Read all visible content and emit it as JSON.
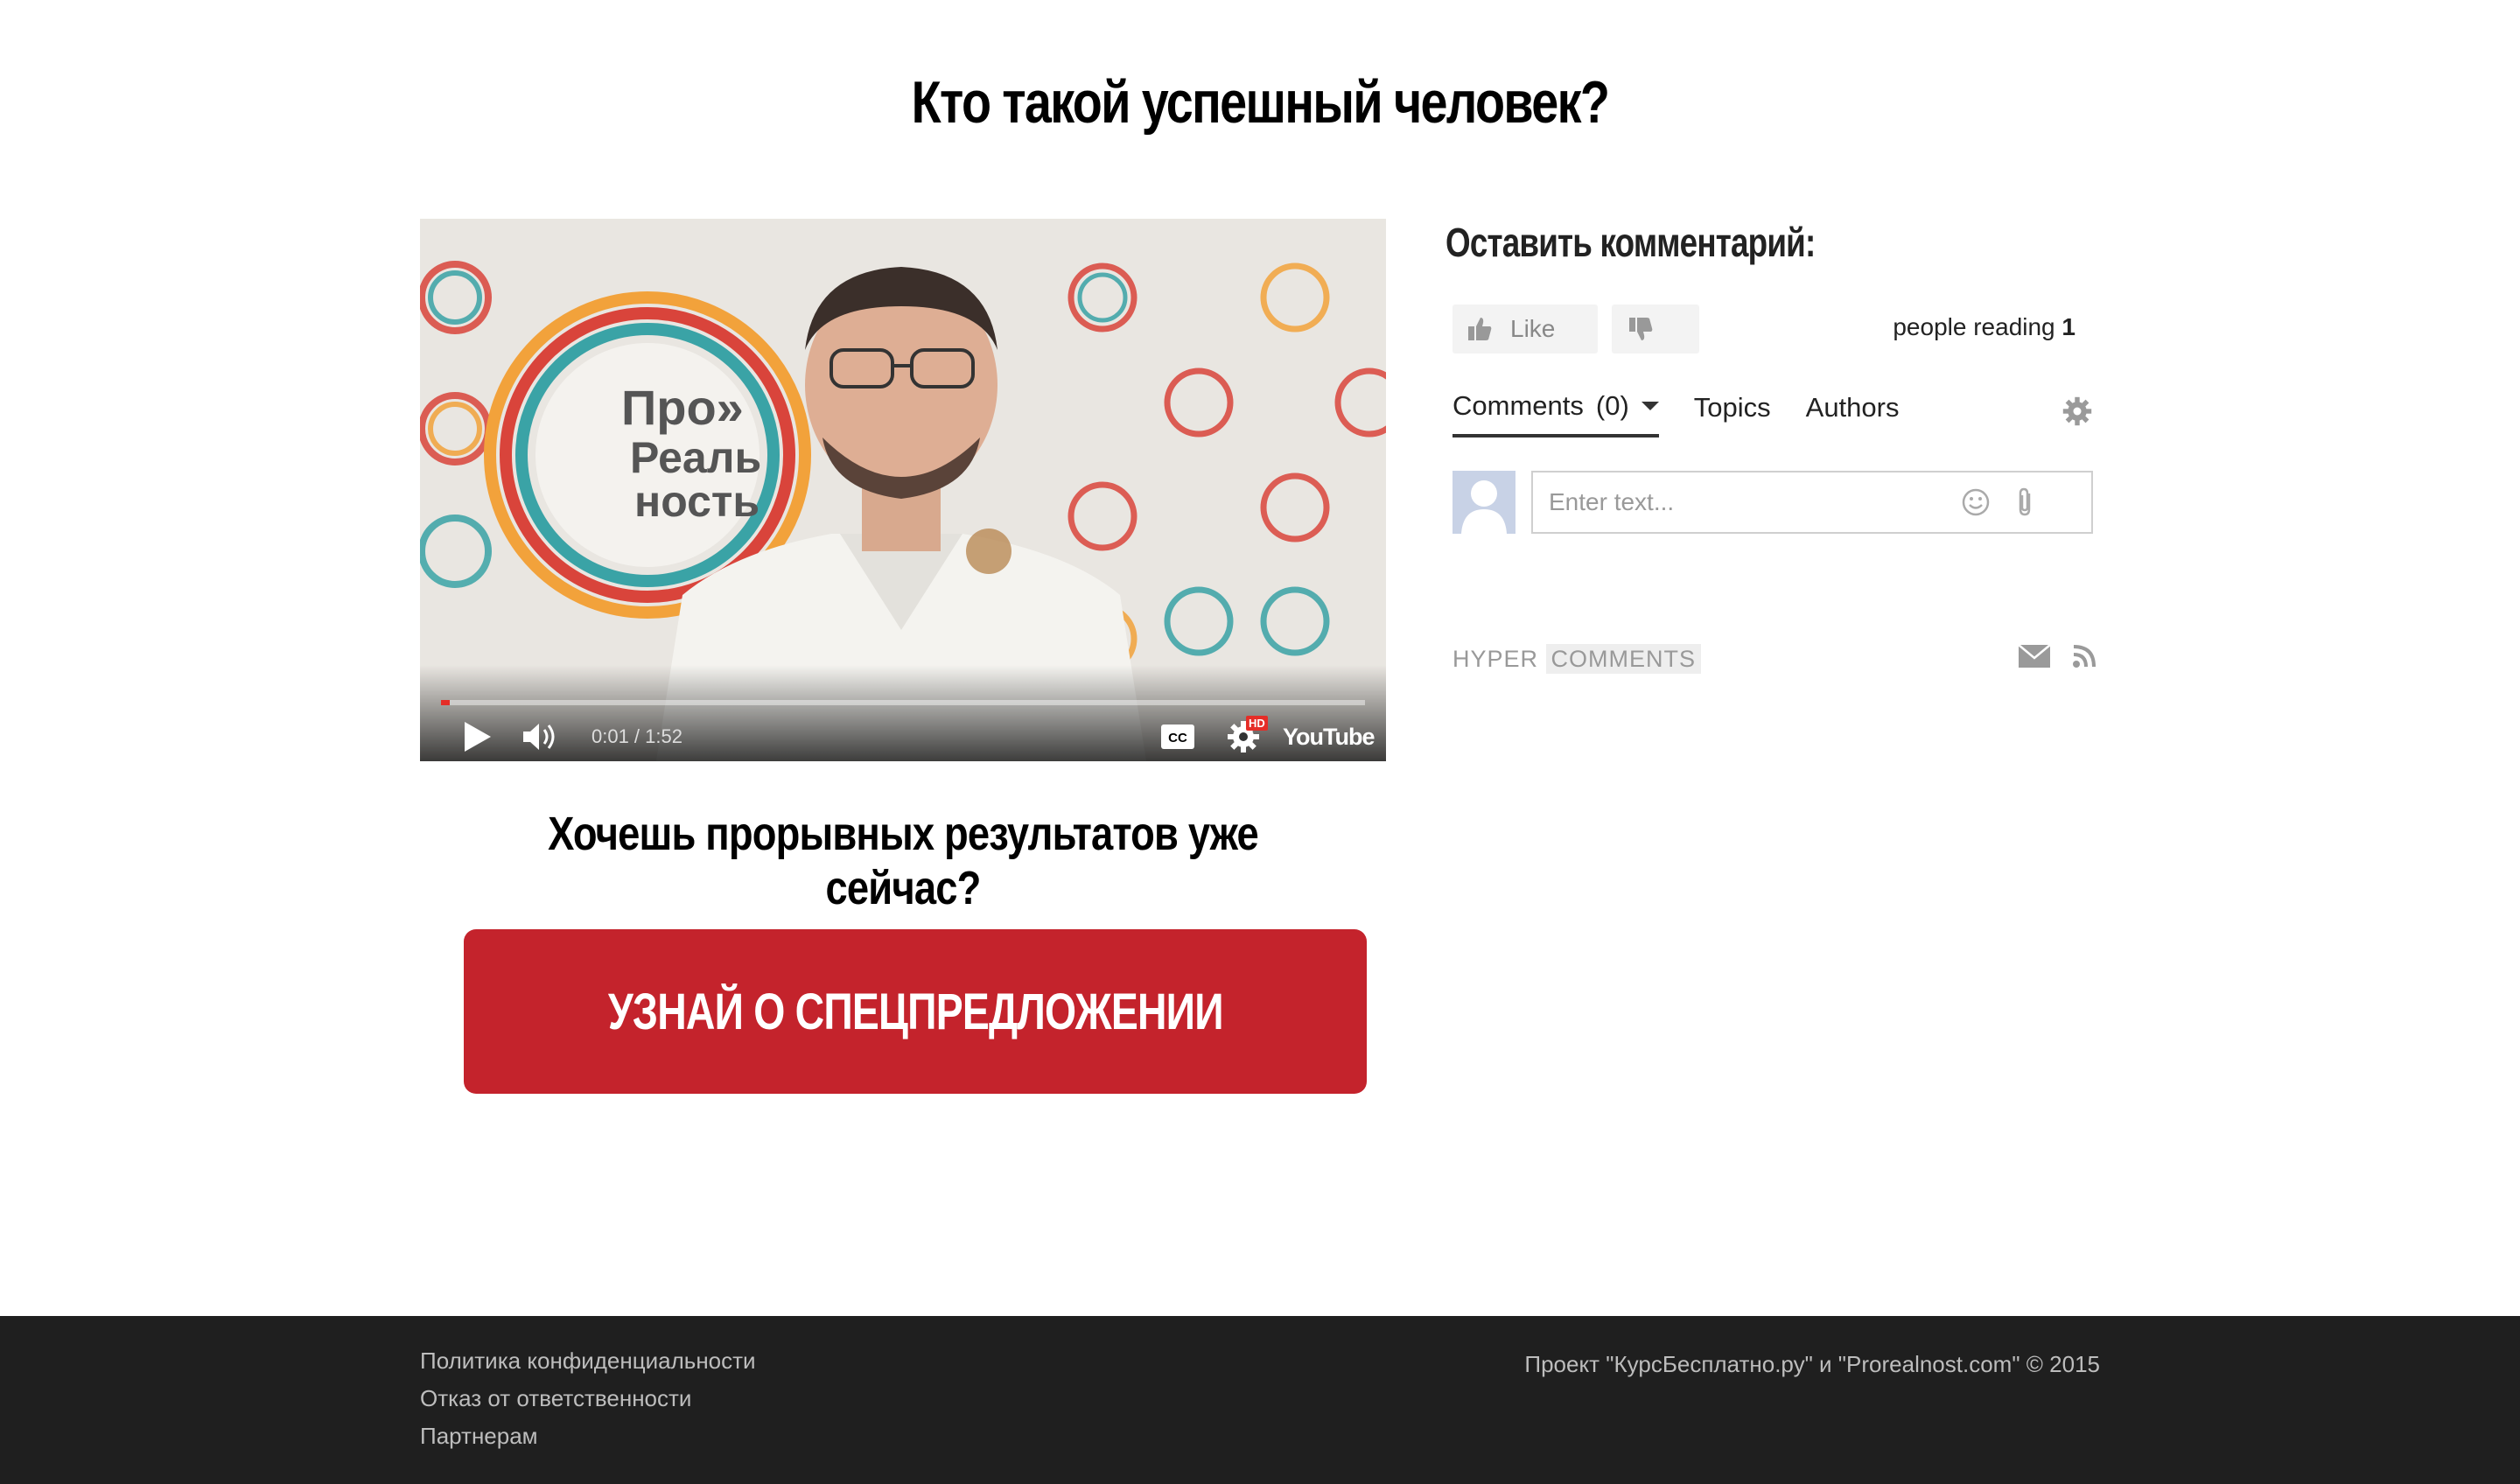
{
  "page": {
    "title": "Кто такой успешный человек?",
    "subheading": "Хочешь прорывных результатов уже сейчас?",
    "cta_label": "УЗНАЙ О СПЕЦПРЕДЛОЖЕНИИ"
  },
  "video": {
    "current_time": "0:01",
    "duration": "1:52",
    "time_display": "0:01 / 1:52",
    "progress_fraction": 0.009,
    "hd_badge": "HD",
    "cc_label": "CC",
    "youtube_label": "YouTube"
  },
  "comments": {
    "heading": "Оставить комментарий:",
    "like_label": "Like",
    "people_reading_label": "people reading",
    "people_reading_count": "1",
    "tabs": [
      {
        "label": "Comments",
        "count": "(0)"
      },
      {
        "label": "Topics"
      },
      {
        "label": "Authors"
      }
    ],
    "input_placeholder": "Enter text...",
    "brand_hyper": "HYPER",
    "brand_comments": "COMMENTS"
  },
  "footer": {
    "links": [
      "Политика конфиденциальности",
      "Отказ от ответственности",
      "Партнерам"
    ],
    "copyright": "Проект \"КурсБесплатно.ру\" и \"Prorealnost.com\" © 2015"
  },
  "colors": {
    "cta": "#c4232c",
    "footer_bg": "#1f1f1f",
    "youtube_red": "#e52d27"
  }
}
